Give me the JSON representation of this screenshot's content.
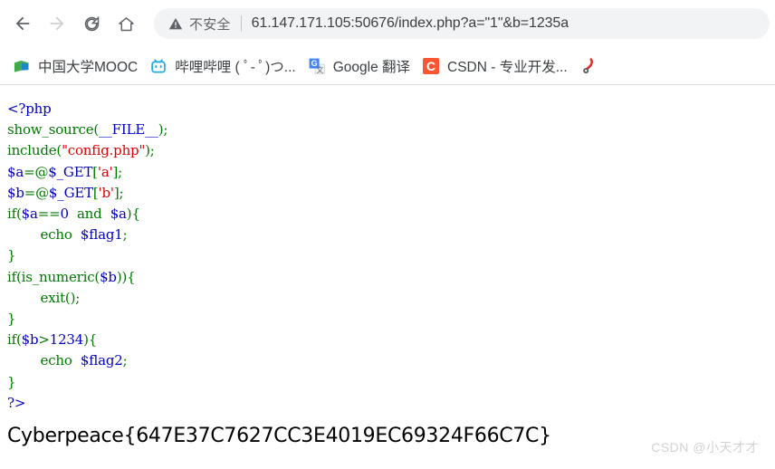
{
  "browser": {
    "nav": {
      "back_label": "Back",
      "forward_label": "Forward",
      "reload_label": "Reload",
      "home_label": "Home"
    },
    "omnibox": {
      "security_text": "不安全",
      "security_icon": "warning-triangle-icon",
      "url": "61.147.171.105:50676/index.php?a=\"1\"&b=1235a"
    },
    "bookmarks": [
      {
        "label": "中国大学MOOC",
        "icon": "mooc-book-icon",
        "color": "#4a9f3c"
      },
      {
        "label": "哔哩哔哩 ( ﾟ- ﾟ)つ...",
        "icon": "bilibili-tv-icon",
        "color": "#22a9e6"
      },
      {
        "label": "Google 翻译",
        "icon": "google-translate-icon",
        "color": "#4285f4"
      },
      {
        "label": "CSDN - 专业开发...",
        "icon": "csdn-icon",
        "color": "#fc5531",
        "glyph": "C"
      },
      {
        "label": "",
        "icon": "sogou-pepper-icon",
        "color": "#e02f27"
      }
    ]
  },
  "page": {
    "code_lines": [
      [
        {
          "t": "<?php",
          "c": "t-var"
        }
      ],
      [
        {
          "t": "show_source",
          "c": "t-kw"
        },
        {
          "t": "(",
          "c": "t-kw"
        },
        {
          "t": "__FILE__",
          "c": "t-var"
        },
        {
          "t": ")",
          "c": "t-kw"
        },
        {
          "t": ";",
          "c": "t-kw"
        }
      ],
      [
        {
          "t": "include",
          "c": "t-kw"
        },
        {
          "t": "(",
          "c": "t-kw"
        },
        {
          "t": "\"config.php\"",
          "c": "t-str"
        },
        {
          "t": ")",
          "c": "t-kw"
        },
        {
          "t": ";",
          "c": "t-kw"
        }
      ],
      [
        {
          "t": "$a",
          "c": "t-var"
        },
        {
          "t": "=@",
          "c": "t-kw"
        },
        {
          "t": "$_GET",
          "c": "t-var"
        },
        {
          "t": "[",
          "c": "t-kw"
        },
        {
          "t": "'a'",
          "c": "t-str"
        },
        {
          "t": "]",
          "c": "t-kw"
        },
        {
          "t": ";",
          "c": "t-kw"
        }
      ],
      [
        {
          "t": "$b",
          "c": "t-var"
        },
        {
          "t": "=@",
          "c": "t-kw"
        },
        {
          "t": "$_GET",
          "c": "t-var"
        },
        {
          "t": "[",
          "c": "t-kw"
        },
        {
          "t": "'b'",
          "c": "t-str"
        },
        {
          "t": "]",
          "c": "t-kw"
        },
        {
          "t": ";",
          "c": "t-kw"
        }
      ],
      [
        {
          "t": "if",
          "c": "t-kw"
        },
        {
          "t": "(",
          "c": "t-kw"
        },
        {
          "t": "$a",
          "c": "t-var"
        },
        {
          "t": "==",
          "c": "t-kw"
        },
        {
          "t": "0",
          "c": "t-num"
        },
        {
          "t": "  ",
          "c": "t-kw"
        },
        {
          "t": "and",
          "c": "t-kw"
        },
        {
          "t": "  ",
          "c": "t-kw"
        },
        {
          "t": "$a",
          "c": "t-var"
        },
        {
          "t": ")",
          "c": "t-kw"
        },
        {
          "t": "{",
          "c": "t-kw"
        }
      ],
      [
        {
          "t": "        ",
          "c": "t-kw"
        },
        {
          "t": "echo",
          "c": "t-kw"
        },
        {
          "t": "  ",
          "c": "t-kw"
        },
        {
          "t": "$flag1",
          "c": "t-var"
        },
        {
          "t": ";",
          "c": "t-kw"
        }
      ],
      [
        {
          "t": "}",
          "c": "t-kw"
        }
      ],
      [
        {
          "t": "if",
          "c": "t-kw"
        },
        {
          "t": "(",
          "c": "t-kw"
        },
        {
          "t": "is_numeric",
          "c": "t-kw"
        },
        {
          "t": "(",
          "c": "t-kw"
        },
        {
          "t": "$b",
          "c": "t-var"
        },
        {
          "t": "))",
          "c": "t-kw"
        },
        {
          "t": "{",
          "c": "t-kw"
        }
      ],
      [
        {
          "t": "        ",
          "c": "t-kw"
        },
        {
          "t": "exit",
          "c": "t-kw"
        },
        {
          "t": "();",
          "c": "t-kw"
        }
      ],
      [
        {
          "t": "}",
          "c": "t-kw"
        }
      ],
      [
        {
          "t": "if",
          "c": "t-kw"
        },
        {
          "t": "(",
          "c": "t-kw"
        },
        {
          "t": "$b",
          "c": "t-var"
        },
        {
          "t": ">",
          "c": "t-kw"
        },
        {
          "t": "1234",
          "c": "t-num"
        },
        {
          "t": ")",
          "c": "t-kw"
        },
        {
          "t": "{",
          "c": "t-kw"
        }
      ],
      [
        {
          "t": "        ",
          "c": "t-kw"
        },
        {
          "t": "echo",
          "c": "t-kw"
        },
        {
          "t": "  ",
          "c": "t-kw"
        },
        {
          "t": "$flag2",
          "c": "t-var"
        },
        {
          "t": ";",
          "c": "t-kw"
        }
      ],
      [
        {
          "t": "}",
          "c": "t-kw"
        }
      ],
      [
        {
          "t": "?>",
          "c": "t-var"
        }
      ]
    ],
    "flag": "Cyberpeace{647E37C7627CC3E4019EC69324F66C7C}",
    "watermark": "CSDN @小天才才"
  }
}
